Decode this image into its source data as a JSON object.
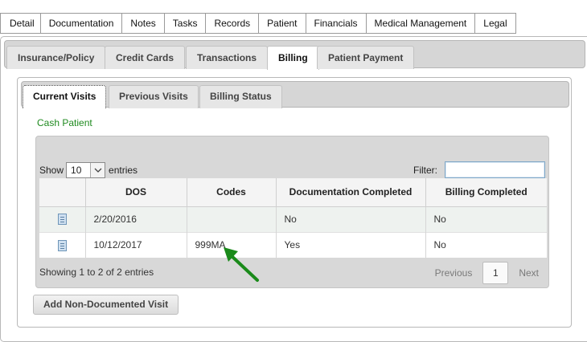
{
  "top_tabs": [
    "Detail",
    "Documentation",
    "Notes",
    "Tasks",
    "Records",
    "Patient",
    "Financials",
    "Medical Management",
    "Legal"
  ],
  "billing_tabs": [
    "Insurance/Policy",
    "Credit Cards",
    "Transactions",
    "Billing",
    "Patient Payment"
  ],
  "visit_tabs": [
    "Current Visits",
    "Previous Visits",
    "Billing Status"
  ],
  "patient_type": "Cash Patient",
  "table": {
    "show_label": "Show",
    "entries_value": "10",
    "entries_label": "entries",
    "filter_label": "Filter:",
    "filter_value": "",
    "columns": [
      "",
      "DOS",
      "Codes",
      "Documentation Completed",
      "Billing Completed"
    ],
    "rows": [
      {
        "dos": "2/20/2016",
        "codes": "",
        "doc_completed": "No",
        "billing_completed": "No"
      },
      {
        "dos": "10/12/2017",
        "codes": "999MA",
        "doc_completed": "Yes",
        "billing_completed": "No"
      }
    ],
    "info": "Showing 1 to 2 of 2 entries",
    "pager": {
      "previous": "Previous",
      "page": "1",
      "next": "Next"
    }
  },
  "add_button": "Add Non-Documented Visit",
  "annotation": {
    "icon": "green-arrow-icon",
    "color": "#1a8a1a"
  }
}
